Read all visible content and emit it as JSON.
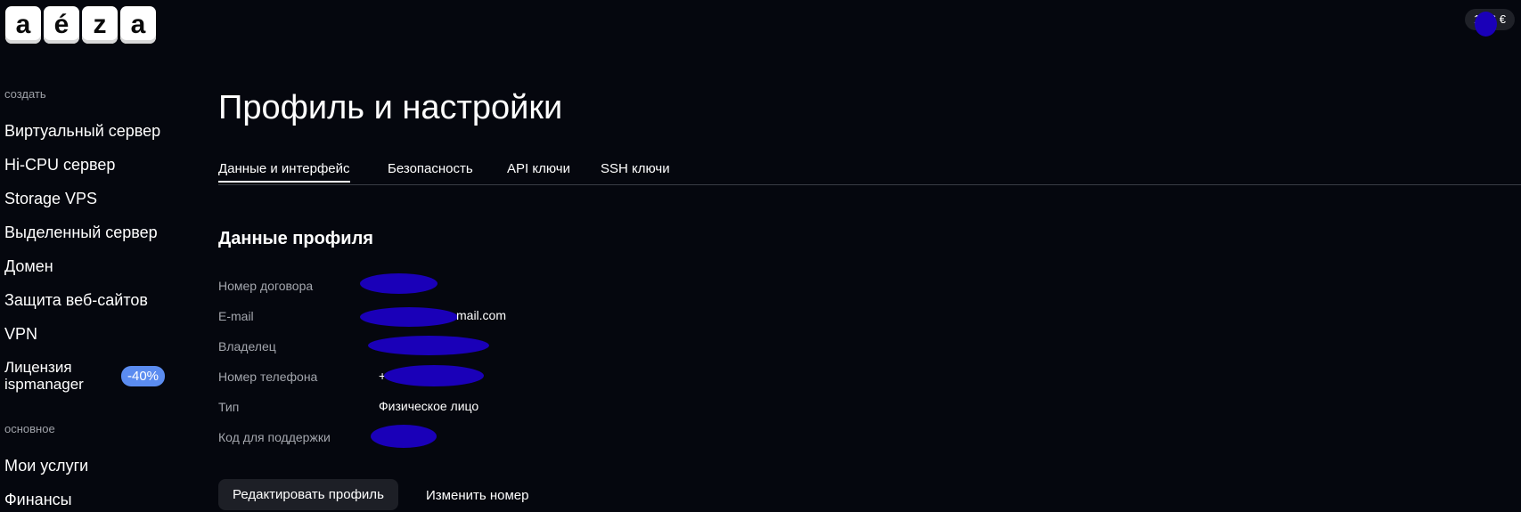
{
  "logo": {
    "letters": [
      "a",
      "é",
      "z",
      "a"
    ]
  },
  "header": {
    "balance": "13.6 €"
  },
  "sidebar": {
    "section_create": "создать",
    "items_create": [
      "Виртуальный сервер",
      "Hi-CPU сервер",
      "Storage VPS",
      "Выделенный сервер",
      "Домен",
      "Защита веб-сайтов",
      "VPN"
    ],
    "license": {
      "line1": "Лицензия",
      "line2": "ispmanager",
      "badge": "-40%"
    },
    "section_main": "основное",
    "items_main": [
      "Мои услуги",
      "Финансы"
    ]
  },
  "main": {
    "title": "Профиль и настройки",
    "tabs": [
      "Данные и интерфейс",
      "Безопасность",
      "API ключи",
      "SSH ключи"
    ],
    "active_tab": "Данные и интерфейс",
    "section_title": "Данные профиля",
    "rows": [
      {
        "label": "Номер договора",
        "value": ""
      },
      {
        "label": "E-mail",
        "value": "mail.com"
      },
      {
        "label": "Владелец",
        "value": ""
      },
      {
        "label": "Номер телефона",
        "value": "+"
      },
      {
        "label": "Тип",
        "value": "Физическое лицо"
      },
      {
        "label": "Код для поддержки",
        "value": ""
      }
    ],
    "edit_button": "Редактировать профиль",
    "change_number": "Изменить номер"
  },
  "colors": {
    "background": "#05070e",
    "badge": "#5b8cf0",
    "redaction": "#1a00b8"
  }
}
